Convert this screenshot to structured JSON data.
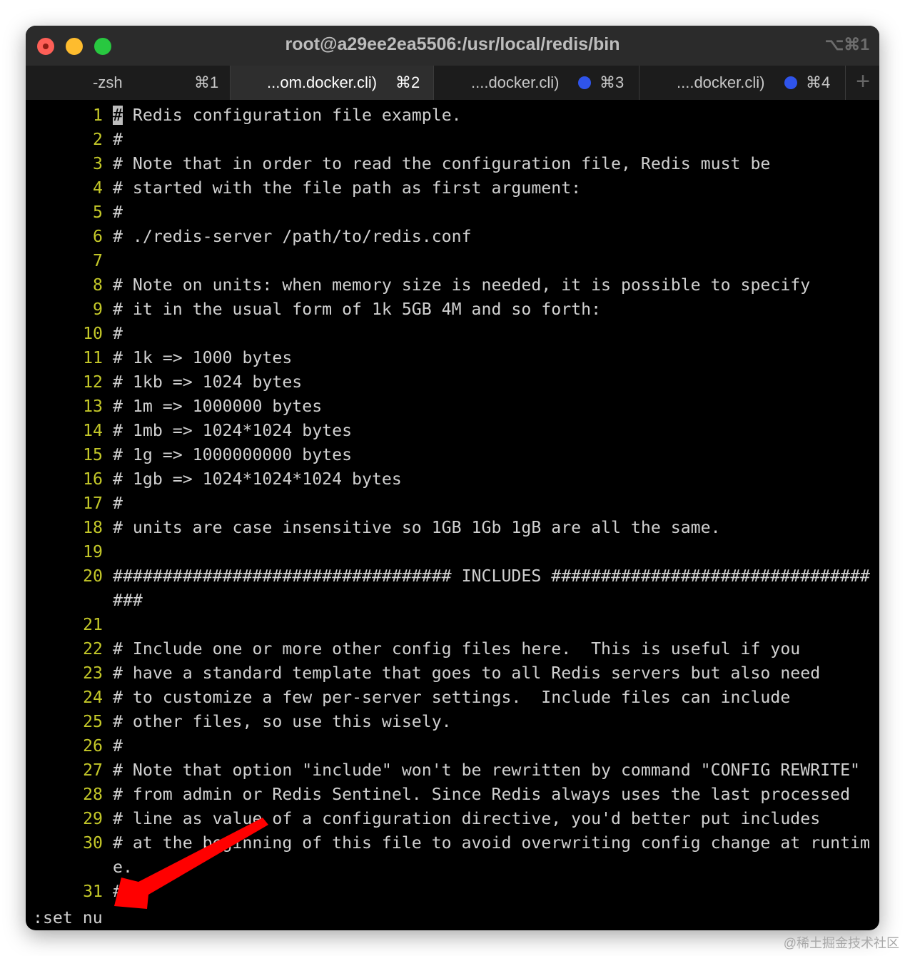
{
  "window": {
    "title": "root@a29ee2ea5506:/usr/local/redis/bin",
    "shortcut": "⌥⌘1"
  },
  "tabs": [
    {
      "label": "-zsh",
      "key": "⌘1",
      "active": false,
      "dot": false
    },
    {
      "label": "...om.docker.cli)",
      "key": "⌘2",
      "active": true,
      "dot": false
    },
    {
      "label": "....docker.cli)",
      "key": "⌘3",
      "active": false,
      "dot": true
    },
    {
      "label": "....docker.cli)",
      "key": "⌘4",
      "active": false,
      "dot": true
    }
  ],
  "new_tab": "+",
  "editor": {
    "cursor_char": "#",
    "lines": [
      {
        "n": "1",
        "t": " Redis configuration file example."
      },
      {
        "n": "2",
        "t": "#"
      },
      {
        "n": "3",
        "t": "# Note that in order to read the configuration file, Redis must be"
      },
      {
        "n": "4",
        "t": "# started with the file path as first argument:"
      },
      {
        "n": "5",
        "t": "#"
      },
      {
        "n": "6",
        "t": "# ./redis-server /path/to/redis.conf"
      },
      {
        "n": "7",
        "t": ""
      },
      {
        "n": "8",
        "t": "# Note on units: when memory size is needed, it is possible to specify"
      },
      {
        "n": "9",
        "t": "# it in the usual form of 1k 5GB 4M and so forth:"
      },
      {
        "n": "10",
        "t": "#"
      },
      {
        "n": "11",
        "t": "# 1k => 1000 bytes"
      },
      {
        "n": "12",
        "t": "# 1kb => 1024 bytes"
      },
      {
        "n": "13",
        "t": "# 1m => 1000000 bytes"
      },
      {
        "n": "14",
        "t": "# 1mb => 1024*1024 bytes"
      },
      {
        "n": "15",
        "t": "# 1g => 1000000000 bytes"
      },
      {
        "n": "16",
        "t": "# 1gb => 1024*1024*1024 bytes"
      },
      {
        "n": "17",
        "t": "#"
      },
      {
        "n": "18",
        "t": "# units are case insensitive so 1GB 1Gb 1gB are all the same."
      },
      {
        "n": "19",
        "t": ""
      },
      {
        "n": "20",
        "t": "################################## INCLUDES ###################################"
      },
      {
        "n": "21",
        "t": ""
      },
      {
        "n": "22",
        "t": "# Include one or more other config files here.  This is useful if you"
      },
      {
        "n": "23",
        "t": "# have a standard template that goes to all Redis servers but also need"
      },
      {
        "n": "24",
        "t": "# to customize a few per-server settings.  Include files can include"
      },
      {
        "n": "25",
        "t": "# other files, so use this wisely."
      },
      {
        "n": "26",
        "t": "#"
      },
      {
        "n": "27",
        "t": "# Note that option \"include\" won't be rewritten by command \"CONFIG REWRITE\""
      },
      {
        "n": "28",
        "t": "# from admin or Redis Sentinel. Since Redis always uses the last processed"
      },
      {
        "n": "29",
        "t": "# line as value of a configuration directive, you'd better put includes"
      },
      {
        "n": "30",
        "t": "# at the beginning of this file to avoid overwriting config change at runtime."
      },
      {
        "n": "31",
        "t": "#"
      }
    ],
    "command_line": ":set nu"
  },
  "watermark": "@稀土掘金技术社区",
  "colors": {
    "line_number": "#c4c829",
    "text": "#d0d0d0",
    "arrow": "#ff0000",
    "tab_dot": "#2f54eb"
  }
}
